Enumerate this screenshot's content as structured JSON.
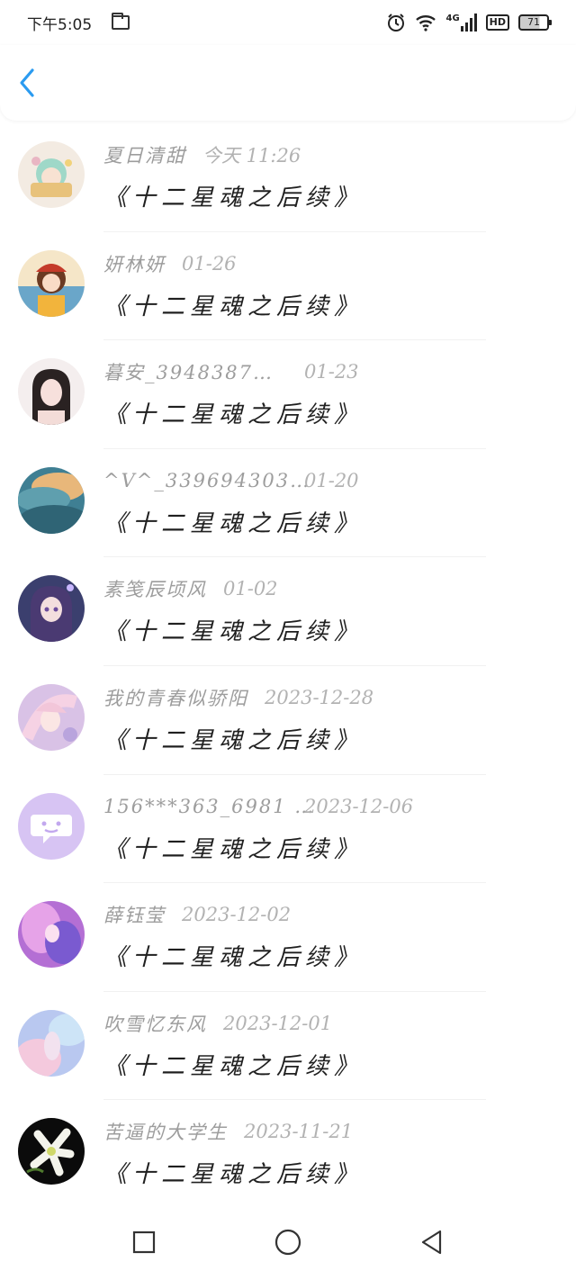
{
  "status_bar": {
    "time": "下午5:05",
    "network": "4G",
    "hd": "HD",
    "battery": "71",
    "icons": [
      "folder-icon",
      "alarm-icon",
      "wifi-icon",
      "signal-icon",
      "battery-icon"
    ]
  },
  "header": {
    "back_icon": "chevron-left-icon",
    "accent": "#2b9bf0"
  },
  "items": [
    {
      "name": "夏日清甜",
      "date": "今天 11:26",
      "title": "《十二星魂之后续》",
      "avatar": "anime-avatar-1"
    },
    {
      "name": "妍林妍",
      "date": "01-26",
      "title": "《十二星魂之后续》",
      "avatar": "anime-avatar-2"
    },
    {
      "name": "暮安_3948387…",
      "date": "01-23",
      "title": "《十二星魂之后续》",
      "avatar": "photo-avatar"
    },
    {
      "name": "^V^_339694303…",
      "date": "01-20",
      "title": "《十二星魂之后续》",
      "avatar": "sky-avatar"
    },
    {
      "name": "素笺辰顷风",
      "date": "01-02",
      "title": "《十二星魂之后续》",
      "avatar": "anime-avatar-3"
    },
    {
      "name": "我的青春似骄阳",
      "date": "2023-12-28",
      "title": "《十二星魂之后续》",
      "avatar": "anime-avatar-4"
    },
    {
      "name": "156***363_6981 …",
      "date": "2023-12-06",
      "title": "《十二星魂之后续》",
      "avatar": "default-chat-avatar"
    },
    {
      "name": "薛钰莹",
      "date": "2023-12-02",
      "title": "《十二星魂之后续》",
      "avatar": "anime-avatar-5"
    },
    {
      "name": "吹雪忆东风",
      "date": "2023-12-01",
      "title": "《十二星魂之后续》",
      "avatar": "pastel-avatar"
    },
    {
      "name": "苦逼的大学生",
      "date": "2023-11-21",
      "title": "《十二星魂之后续》",
      "avatar": "lily-avatar"
    }
  ],
  "nav_bar": {
    "icons": [
      "recent-apps-icon",
      "home-icon",
      "back-triangle-icon"
    ]
  }
}
